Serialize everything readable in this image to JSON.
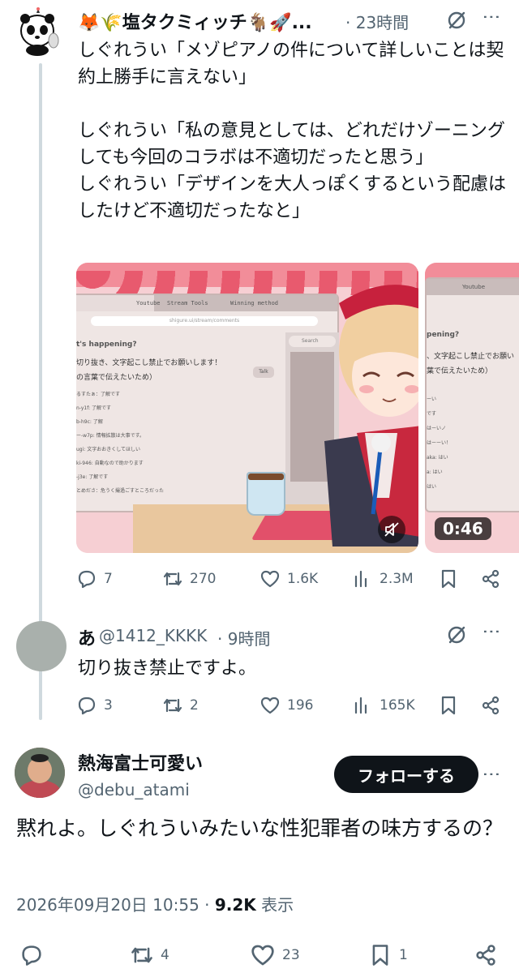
{
  "tweet1": {
    "display_name": "🦊🌾塩タクミィッチ🐐🚀...",
    "time": "· 23時間",
    "body": "しぐれうい「メゾピアノの件について詳しいことは契約上勝手に言えない」\n\nしぐれうい「私の意見としては、どれだけゾーニングしても今回のコラボは不適切だったと思う」\nしぐれうい「デザインを大人っぽくするという配慮はしたけど不適切だったなと」",
    "media": {
      "tabs": [
        "Youtube",
        "Stream Tools",
        "Winning method"
      ],
      "url": "shigure.ui/stream/comments",
      "panel_title": "t's happening?",
      "notice_line1": "切り抜き、文字起こし禁止でお願いします！",
      "notice_line2": "の言葉で伝えたいため）",
      "talk_label": "Talk",
      "search_label": "Search",
      "comments": [
        "るすたぁ：了解です",
        "n-y1f: 了解です",
        "b-h9c: 了解",
        "ー-w7p: 情報拡散は大事です。",
        "ugi: 文字おおきくしてほしい",
        "ki-946: 自動なので助かります",
        "-j3e: 了解です",
        "とめださ：危うく撮過ごすところだった"
      ],
      "second_tab": "Youtube",
      "second_panel_title": "pening?",
      "second_notice": "、文字起こし禁止でお願い",
      "second_notice2": "葉で伝えたいため）",
      "second_comments": [
        "ーい",
        "です",
        "はーいノ",
        "はーーい！",
        "aka: はい",
        "a: はい",
        "はい"
      ],
      "duration": "0:46"
    },
    "stats": {
      "replies": "7",
      "retweets": "270",
      "likes": "1.6K",
      "views": "2.3M"
    }
  },
  "tweet2": {
    "display_name": "あ",
    "handle": "@1412_KKKK",
    "time": "· 9時間",
    "body": "切り抜き禁止ですよ。",
    "stats": {
      "replies": "3",
      "retweets": "2",
      "likes": "196",
      "views": "165K"
    }
  },
  "main": {
    "display_name": "熱海富士可愛い",
    "handle": "@debu_atami",
    "follow_label": "フォローする",
    "body": "黙れよ。しぐれういみたいな性犯罪者の味方するの？",
    "timestamp": "2026年09月20日 10:55",
    "dot": " · ",
    "views_count": "9.2K",
    "views_label": " 表示",
    "stats": {
      "retweets": "4",
      "likes": "23",
      "bookmarks": "1"
    }
  },
  "colors": {
    "text": "#0f1419",
    "muted": "#536471",
    "line": "#cfd9de",
    "pink": "#f06a7e"
  }
}
